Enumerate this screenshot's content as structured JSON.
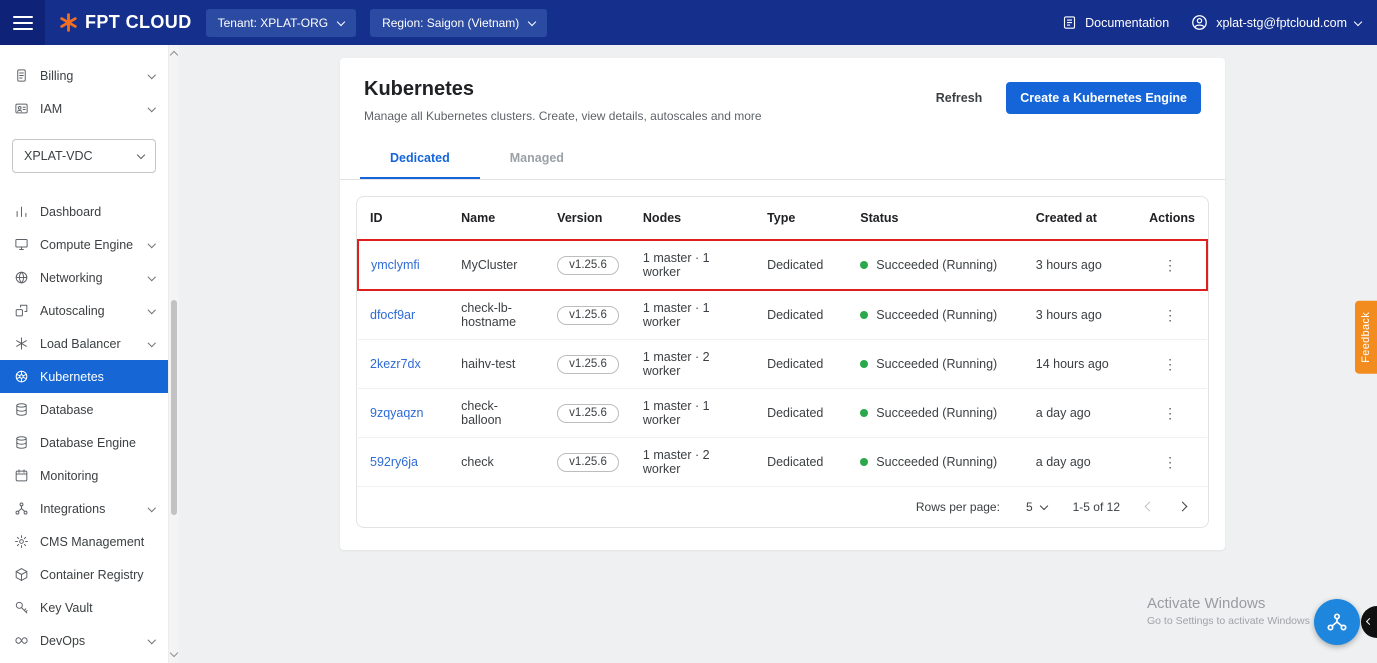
{
  "colors": {
    "topbar": "#15308C",
    "accent_blue": "#1565D8",
    "active_sidebar": "#1666D6",
    "status_green": "#2BA84A",
    "highlight_red": "#E01E1E",
    "feedback_orange": "#F28C1E",
    "link_blue": "#2E6BD6"
  },
  "topbar": {
    "brand": "FPT CLOUD",
    "tenant_label": "Tenant: XPLAT-ORG",
    "region_label": "Region: Saigon (Vietnam)",
    "documentation_label": "Documentation",
    "account_email": "xplat-stg@fptcloud.com"
  },
  "sidebar": {
    "top_items": [
      {
        "label": "Billing",
        "icon": "billing-icon",
        "chevron": true
      },
      {
        "label": "IAM",
        "icon": "iam-icon",
        "chevron": true
      }
    ],
    "vdc_select": "XPLAT-VDC",
    "items": [
      {
        "label": "Dashboard",
        "icon": "dashboard-icon"
      },
      {
        "label": "Compute Engine",
        "icon": "compute-engine-icon",
        "chevron": true
      },
      {
        "label": "Networking",
        "icon": "networking-icon",
        "chevron": true
      },
      {
        "label": "Autoscaling",
        "icon": "autoscaling-icon",
        "chevron": true
      },
      {
        "label": "Load Balancer",
        "icon": "load-balancer-icon",
        "chevron": true
      },
      {
        "label": "Kubernetes",
        "icon": "kubernetes-icon",
        "active": true
      },
      {
        "label": "Database",
        "icon": "database-icon"
      },
      {
        "label": "Database Engine",
        "icon": "database-engine-icon"
      },
      {
        "label": "Monitoring",
        "icon": "monitoring-icon"
      },
      {
        "label": "Integrations",
        "icon": "integrations-icon",
        "chevron": true
      },
      {
        "label": "CMS Management",
        "icon": "cms-management-icon"
      },
      {
        "label": "Container Registry",
        "icon": "container-registry-icon"
      },
      {
        "label": "Key Vault",
        "icon": "key-vault-icon"
      },
      {
        "label": "DevOps",
        "icon": "devops-icon",
        "chevron": true
      }
    ]
  },
  "main": {
    "title": "Kubernetes",
    "subtitle": "Manage all Kubernetes clusters. Create, view details, autoscales and more",
    "refresh_label": "Refresh",
    "create_button_label": "Create a Kubernetes Engine",
    "tabs": [
      {
        "label": "Dedicated",
        "active": true
      },
      {
        "label": "Managed",
        "active": false
      }
    ],
    "table": {
      "columns": [
        "ID",
        "Name",
        "Version",
        "Nodes",
        "Type",
        "Status",
        "Created at",
        "Actions"
      ],
      "rows": [
        {
          "id": "ymclymfi",
          "name": "MyCluster",
          "version": "v1.25.6",
          "nodes": "1 master · 1 worker",
          "type": "Dedicated",
          "status": "Succeeded (Running)",
          "created": "3 hours ago",
          "highlighted": true
        },
        {
          "id": "dfocf9ar",
          "name": "check-lb-hostname",
          "version": "v1.25.6",
          "nodes": "1 master · 1 worker",
          "type": "Dedicated",
          "status": "Succeeded (Running)",
          "created": "3 hours ago",
          "highlighted": false
        },
        {
          "id": "2kezr7dx",
          "name": "haihv-test",
          "version": "v1.25.6",
          "nodes": "1 master · 2 worker",
          "type": "Dedicated",
          "status": "Succeeded (Running)",
          "created": "14 hours ago",
          "highlighted": false
        },
        {
          "id": "9zqyaqzn",
          "name": "check-balloon",
          "version": "v1.25.6",
          "nodes": "1 master · 1 worker",
          "type": "Dedicated",
          "status": "Succeeded (Running)",
          "created": "a day ago",
          "highlighted": false
        },
        {
          "id": "592ry6ja",
          "name": "check",
          "version": "v1.25.6",
          "nodes": "1 master · 2 worker",
          "type": "Dedicated",
          "status": "Succeeded (Running)",
          "created": "a day ago",
          "highlighted": false
        }
      ]
    },
    "pagination": {
      "rows_per_page_label": "Rows per page:",
      "rows_per_page_value": "5",
      "range_label": "1-5 of 12"
    }
  },
  "feedback_tab_label": "Feedback",
  "watermark": {
    "title": "Activate Windows",
    "subtitle": "Go to Settings to activate Windows"
  }
}
